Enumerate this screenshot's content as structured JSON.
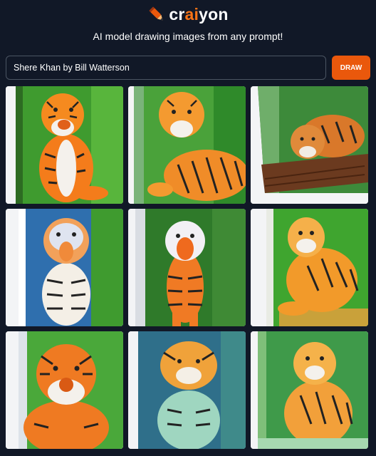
{
  "header": {
    "logo_prefix": "cr",
    "logo_ai": "ai",
    "logo_suffix": "yon",
    "tagline": "AI model drawing images from any prompt!"
  },
  "prompt": {
    "value": "Shere Khan by Bill Watterson",
    "button_label": "DRAW"
  },
  "colors": {
    "background": "#111827",
    "accent": "#ea580c",
    "logo_ai": "#f97316"
  },
  "icons": [
    "pencil-icon"
  ]
}
